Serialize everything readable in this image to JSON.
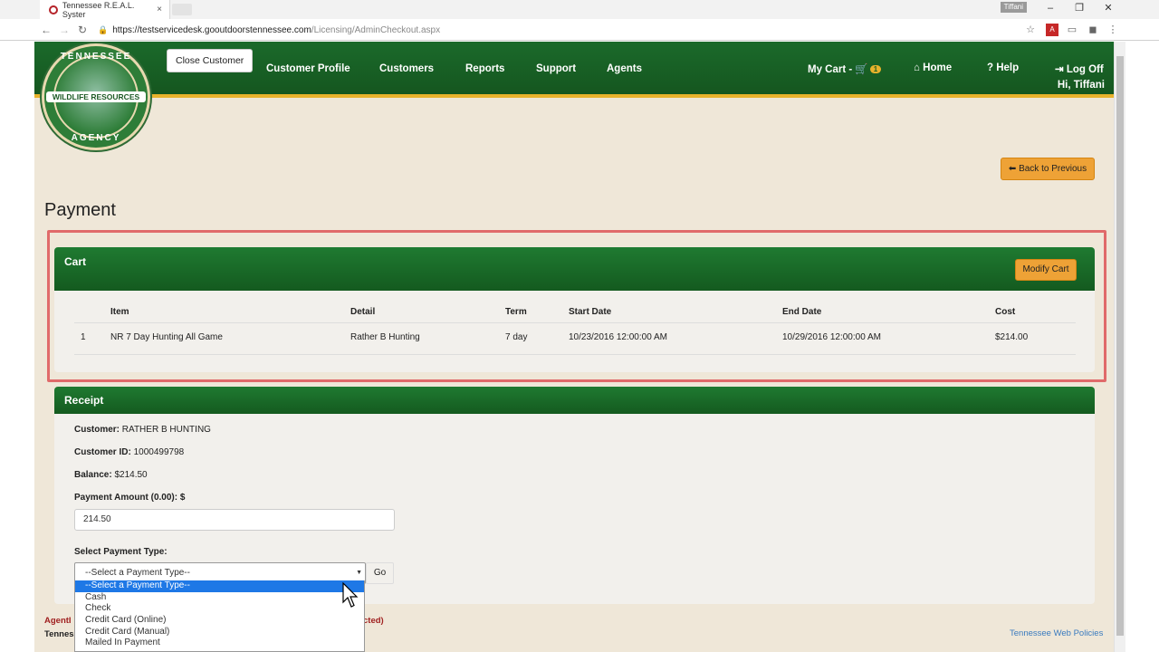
{
  "browser": {
    "tab_title": "Tennessee R.E.A.L. Syster",
    "tab_close": "×",
    "window_user": "Tiffani",
    "url_host": "https://testservicedesk.gooutdoorstennessee.com",
    "url_path": "/Licensing/AdminCheckout.aspx",
    "url_lock": "🔒"
  },
  "header": {
    "logo_top": "TENNESSEE",
    "logo_mid": "WILDLIFE RESOURCES",
    "logo_bottom": "AGENCY",
    "close_customer": "Close Customer",
    "nav": [
      "Customer Profile",
      "Customers",
      "Reports",
      "Support",
      "Agents"
    ],
    "my_cart": "My Cart -",
    "cart_count": "1",
    "home": "Home",
    "help": "Help",
    "log_off": "Log Off",
    "greeting": "Hi, Tiffani"
  },
  "back_button": "Back to Previous",
  "page_title": "Payment",
  "cart": {
    "title": "Cart",
    "modify_button": "Modify Cart",
    "columns": [
      "Item",
      "Detail",
      "Term",
      "Start Date",
      "End Date",
      "Cost"
    ],
    "rows": [
      {
        "num": "1",
        "item": "NR 7 Day Hunting All Game",
        "detail": "Rather B Hunting",
        "term": "7 day",
        "start": "10/23/2016 12:00:00 AM",
        "end": "10/29/2016 12:00:00 AM",
        "cost": "$214.00"
      }
    ]
  },
  "receipt": {
    "title": "Receipt",
    "customer_label": "Customer:",
    "customer_value": "RATHER B HUNTING",
    "customer_id_label": "Customer ID:",
    "customer_id_value": "1000499798",
    "balance_label": "Balance:",
    "balance_value": "$214.50",
    "payment_amount_label": "Payment Amount (0.00): $",
    "payment_amount_value": "214.50",
    "payment_type_label": "Select Payment Type:",
    "payment_type_selected": "--Select a Payment Type--",
    "go_button": "Go",
    "payment_options": [
      "--Select a Payment Type--",
      "Cash",
      "Check",
      "Credit Card (Online)",
      "Credit Card (Manual)",
      "Mailed In Payment"
    ]
  },
  "footer": {
    "agent_fragment": "AgentI",
    "tennessee_fragment": "Tennes",
    "protected_fragment": "cted)",
    "web_policies": "Tennessee Web Policies"
  },
  "colors": {
    "header_green": "#1b6a2b",
    "accent_gold": "#e8b22c",
    "button_orange": "#eea236",
    "page_bg": "#efe7d8",
    "highlight_red": "#e06a6a",
    "selected_blue": "#1e78e6"
  }
}
